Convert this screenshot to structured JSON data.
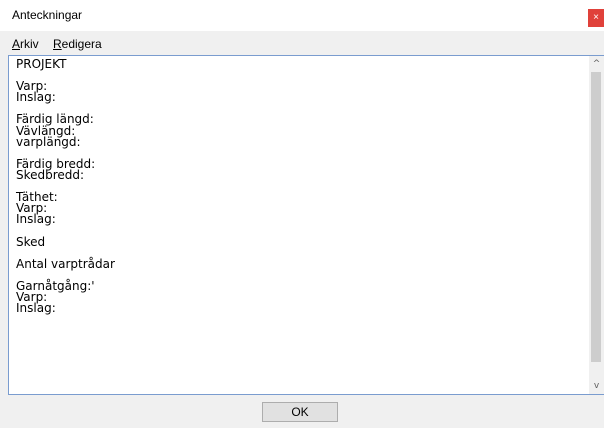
{
  "window": {
    "title": "Anteckningar",
    "close_symbol": "×"
  },
  "menu": {
    "items": [
      {
        "accel": "A",
        "rest": "rkiv"
      },
      {
        "accel": "R",
        "rest": "edigera"
      }
    ]
  },
  "editor": {
    "text": "PROJEKT\n\nVarp:\nInslag:\n\nFärdig längd:\nVävlängd:\nvarplängd:\n\nFärdig bredd:\nSkedbredd:\n\nTäthet:\nVarp:\nInslag:\n\nSked\n\nAntal varptrådar\n\nGarnåtgång:'\nVarp:\nInslag:"
  },
  "scrollbar": {
    "up_symbol": "^",
    "down_symbol": "v"
  },
  "buttons": {
    "ok_label": "OK"
  },
  "colors": {
    "close_button": "#e0413a",
    "editor_border": "#7a9ccf"
  }
}
